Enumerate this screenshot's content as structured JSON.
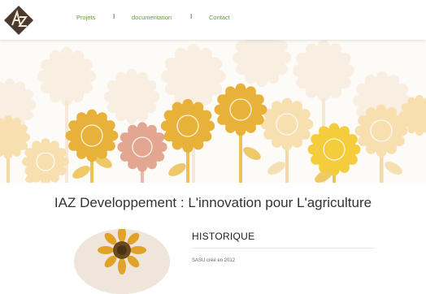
{
  "nav": {
    "items": [
      {
        "label": "Projets"
      },
      {
        "label": "documentation"
      },
      {
        "label": "Contact"
      }
    ],
    "separator": "I"
  },
  "logo": {
    "text": "IAZ"
  },
  "hero": {
    "image": "sunflowers-banner"
  },
  "main": {
    "title": "IAZ Developpement : L'innovation pour L'agriculture"
  },
  "historique": {
    "title": "HISTORIQUE",
    "text": "SASU créé en 2012"
  },
  "colors": {
    "accent_green": "#5f9f2f",
    "sunflower_gold": "#e8b23a",
    "sunflower_pale": "#f6e1bb",
    "sunflower_pink": "#e3a690"
  }
}
